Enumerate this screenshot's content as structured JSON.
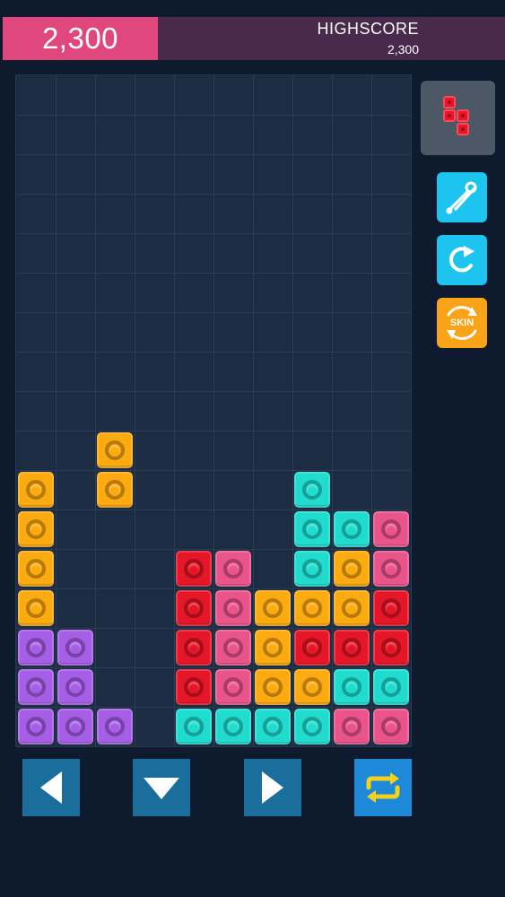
{
  "score": {
    "current": "2,300"
  },
  "highscore": {
    "label": "HIGHSCORE",
    "value": "2,300"
  },
  "board": {
    "columns": 10,
    "rows": 17,
    "blocks": [
      {
        "c": 2,
        "r": 9,
        "color": "orange"
      },
      {
        "c": 0,
        "r": 10,
        "color": "orange"
      },
      {
        "c": 2,
        "r": 10,
        "color": "orange"
      },
      {
        "c": 7,
        "r": 10,
        "color": "cyan"
      },
      {
        "c": 0,
        "r": 11,
        "color": "orange"
      },
      {
        "c": 7,
        "r": 11,
        "color": "cyan"
      },
      {
        "c": 8,
        "r": 11,
        "color": "cyan"
      },
      {
        "c": 9,
        "r": 11,
        "color": "pink"
      },
      {
        "c": 0,
        "r": 12,
        "color": "orange"
      },
      {
        "c": 4,
        "r": 12,
        "color": "red"
      },
      {
        "c": 5,
        "r": 12,
        "color": "pink"
      },
      {
        "c": 7,
        "r": 12,
        "color": "cyan"
      },
      {
        "c": 8,
        "r": 12,
        "color": "orange"
      },
      {
        "c": 9,
        "r": 12,
        "color": "pink"
      },
      {
        "c": 0,
        "r": 13,
        "color": "orange"
      },
      {
        "c": 4,
        "r": 13,
        "color": "red"
      },
      {
        "c": 5,
        "r": 13,
        "color": "pink"
      },
      {
        "c": 6,
        "r": 13,
        "color": "orange"
      },
      {
        "c": 7,
        "r": 13,
        "color": "orange"
      },
      {
        "c": 8,
        "r": 13,
        "color": "orange"
      },
      {
        "c": 9,
        "r": 13,
        "color": "red"
      },
      {
        "c": 0,
        "r": 14,
        "color": "purple"
      },
      {
        "c": 1,
        "r": 14,
        "color": "purple"
      },
      {
        "c": 4,
        "r": 14,
        "color": "red"
      },
      {
        "c": 5,
        "r": 14,
        "color": "pink"
      },
      {
        "c": 6,
        "r": 14,
        "color": "orange"
      },
      {
        "c": 7,
        "r": 14,
        "color": "red"
      },
      {
        "c": 8,
        "r": 14,
        "color": "red"
      },
      {
        "c": 9,
        "r": 14,
        "color": "red"
      },
      {
        "c": 0,
        "r": 15,
        "color": "purple"
      },
      {
        "c": 1,
        "r": 15,
        "color": "purple"
      },
      {
        "c": 4,
        "r": 15,
        "color": "red"
      },
      {
        "c": 5,
        "r": 15,
        "color": "pink"
      },
      {
        "c": 6,
        "r": 15,
        "color": "orange"
      },
      {
        "c": 7,
        "r": 15,
        "color": "orange"
      },
      {
        "c": 8,
        "r": 15,
        "color": "cyan"
      },
      {
        "c": 9,
        "r": 15,
        "color": "cyan"
      },
      {
        "c": 0,
        "r": 16,
        "color": "purple"
      },
      {
        "c": 1,
        "r": 16,
        "color": "purple"
      },
      {
        "c": 2,
        "r": 16,
        "color": "purple"
      },
      {
        "c": 4,
        "r": 16,
        "color": "cyan"
      },
      {
        "c": 5,
        "r": 16,
        "color": "cyan"
      },
      {
        "c": 6,
        "r": 16,
        "color": "cyan"
      },
      {
        "c": 7,
        "r": 16,
        "color": "cyan"
      },
      {
        "c": 8,
        "r": 16,
        "color": "pink"
      },
      {
        "c": 9,
        "r": 16,
        "color": "pink"
      }
    ]
  },
  "colors": {
    "orange": "#fbaa10",
    "cyan": "#20dccf",
    "pink": "#e9548a",
    "red": "#e51628",
    "purple": "#a65ee6",
    "next_piece_bg": "#4d5866",
    "side_blue": "#1ec4f0",
    "skin_orange": "#f9a418",
    "control_blue": "#1a6e9c",
    "rotate_blue": "#1e88d9",
    "rotate_yellow": "#f2d21a"
  },
  "next_piece": {
    "color": "red",
    "cells": [
      {
        "c": 0,
        "r": 0
      },
      {
        "c": 0,
        "r": 1
      },
      {
        "c": 1,
        "r": 1
      },
      {
        "c": 1,
        "r": 2
      }
    ]
  },
  "side_buttons": {
    "settings_icon": "wrench-screwdriver-icon",
    "restart_icon": "restart-arrow-icon",
    "skin_label": "SKIN"
  },
  "controls": {
    "left_icon": "triangle-left-icon",
    "down_icon": "triangle-down-icon",
    "right_icon": "triangle-right-icon",
    "rotate_icon": "rotate-arrows-icon"
  }
}
